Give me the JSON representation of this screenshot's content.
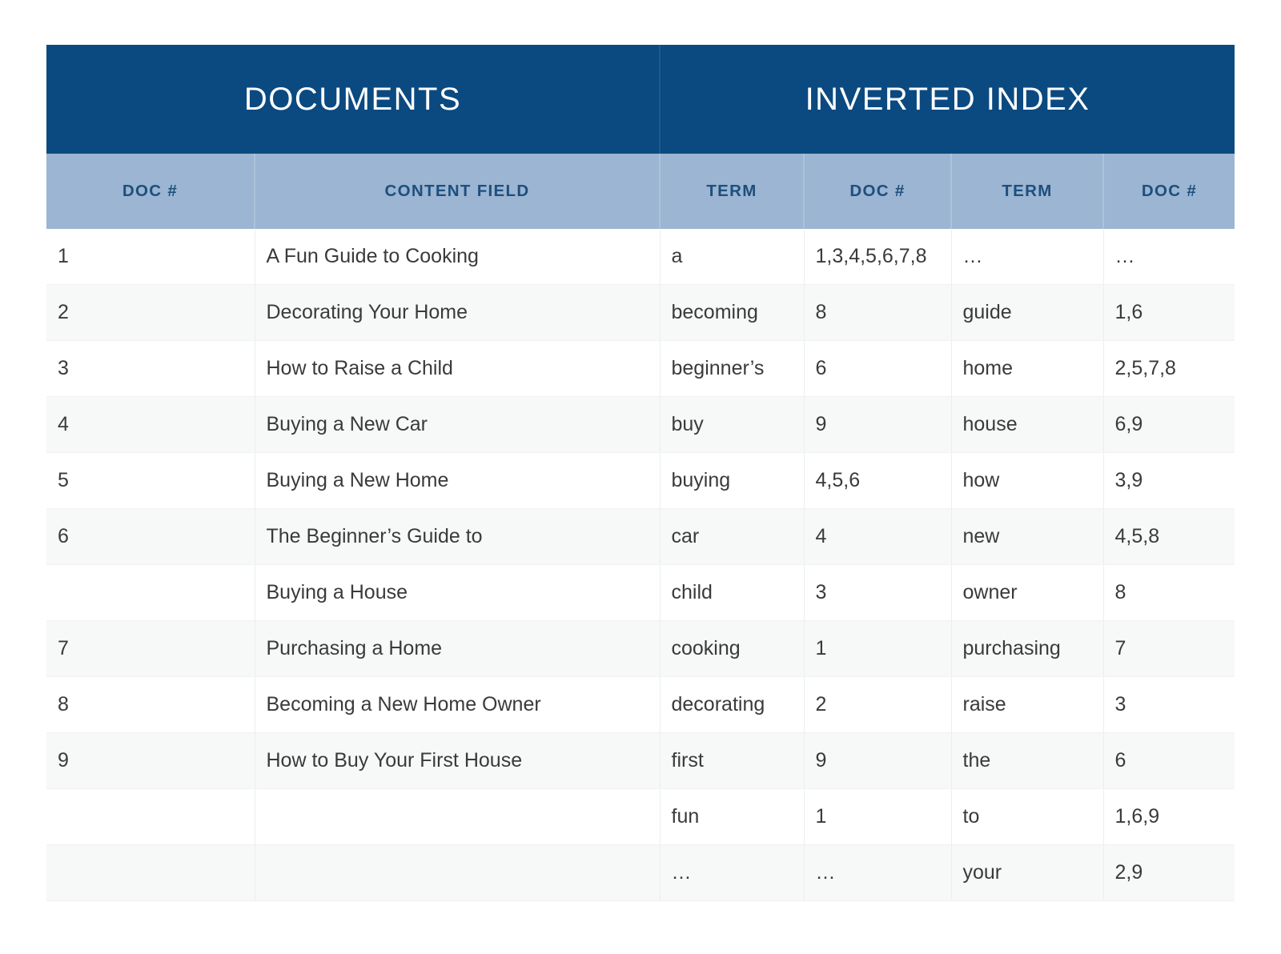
{
  "sections": {
    "documents_title": "DOCUMENTS",
    "inverted_index_title": "INVERTED INDEX"
  },
  "columns": {
    "doc_num": "DOC #",
    "content_field": "CONTENT FIELD",
    "term": "TERM",
    "term_2": "TERM",
    "doc_num_2": "DOC #",
    "doc_num_3": "DOC #"
  },
  "colors": {
    "section_header_bg": "#0b4a80",
    "column_header_bg": "#9bb5d2",
    "column_header_text": "#1d4f7d",
    "row_alt_bg": "#f7f8f8",
    "row_bg": "#ffffff",
    "body_text": "#3a3a3a"
  },
  "rows": [
    {
      "doc": "1",
      "content": "A Fun Guide to Cooking",
      "term_a": "a",
      "docs_a": "1,3,4,5,6,7,8",
      "term_b": "…",
      "docs_b": "…"
    },
    {
      "doc": "2",
      "content": "Decorating Your Home",
      "term_a": "becoming",
      "docs_a": "8",
      "term_b": "guide",
      "docs_b": "1,6"
    },
    {
      "doc": "3",
      "content": "How to Raise a Child",
      "term_a": "beginner’s",
      "docs_a": "6",
      "term_b": "home",
      "docs_b": "2,5,7,8"
    },
    {
      "doc": "4",
      "content": "Buying a New Car",
      "term_a": "buy",
      "docs_a": "9",
      "term_b": "house",
      "docs_b": "6,9"
    },
    {
      "doc": "5",
      "content": "Buying a New Home",
      "term_a": "buying",
      "docs_a": "4,5,6",
      "term_b": "how",
      "docs_b": "3,9"
    },
    {
      "doc": "6",
      "content": "The Beginner’s Guide to",
      "term_a": "car",
      "docs_a": "4",
      "term_b": "new",
      "docs_b": "4,5,8"
    },
    {
      "doc": "",
      "content": "Buying a House",
      "term_a": "child",
      "docs_a": "3",
      "term_b": "owner",
      "docs_b": "8"
    },
    {
      "doc": "7",
      "content": "Purchasing a Home",
      "term_a": "cooking",
      "docs_a": "1",
      "term_b": "purchasing",
      "docs_b": "7"
    },
    {
      "doc": "8",
      "content": "Becoming a New Home Owner",
      "term_a": "decorating",
      "docs_a": "2",
      "term_b": "raise",
      "docs_b": "3"
    },
    {
      "doc": "9",
      "content": "How to Buy Your First House",
      "term_a": "first",
      "docs_a": "9",
      "term_b": "the",
      "docs_b": "6"
    },
    {
      "doc": "",
      "content": "",
      "term_a": "fun",
      "docs_a": "1",
      "term_b": "to",
      "docs_b": "1,6,9"
    },
    {
      "doc": "",
      "content": "",
      "term_a": "…",
      "docs_a": "…",
      "term_b": "your",
      "docs_b": "2,9"
    }
  ]
}
